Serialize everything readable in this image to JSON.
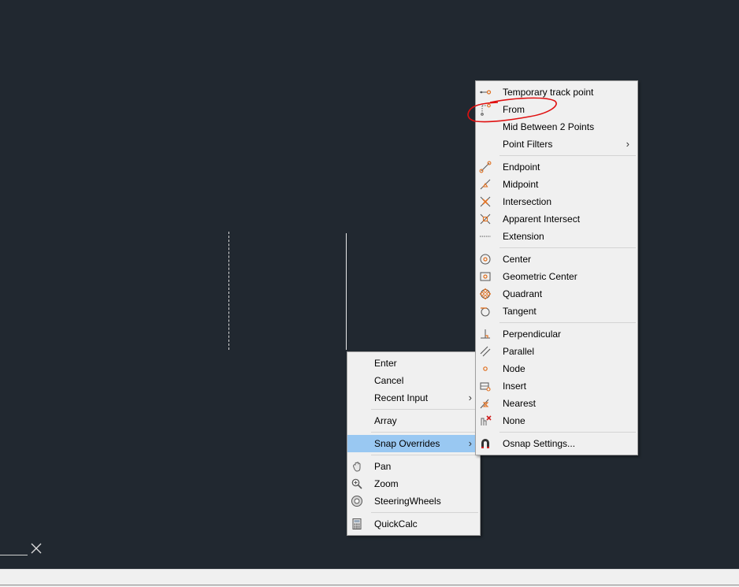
{
  "context_menu": {
    "items": [
      "Enter",
      "Cancel",
      "Recent Input",
      "Array",
      "Snap Overrides",
      "Pan",
      "Zoom",
      "SteeringWheels",
      "QuickCalc"
    ]
  },
  "snap_menu": {
    "items": [
      "Temporary track point",
      "From",
      "Mid Between 2 Points",
      "Point Filters",
      "Endpoint",
      "Midpoint",
      "Intersection",
      "Apparent Intersect",
      "Extension",
      "Center",
      "Geometric Center",
      "Quadrant",
      "Tangent",
      "Perpendicular",
      "Parallel",
      "Node",
      "Insert",
      "Nearest",
      "None",
      "Osnap Settings..."
    ]
  },
  "arrow_glyph": "›",
  "accent_color": "#e07020",
  "highlight_color": "#99c8f2",
  "annotation_color": "#e01010"
}
